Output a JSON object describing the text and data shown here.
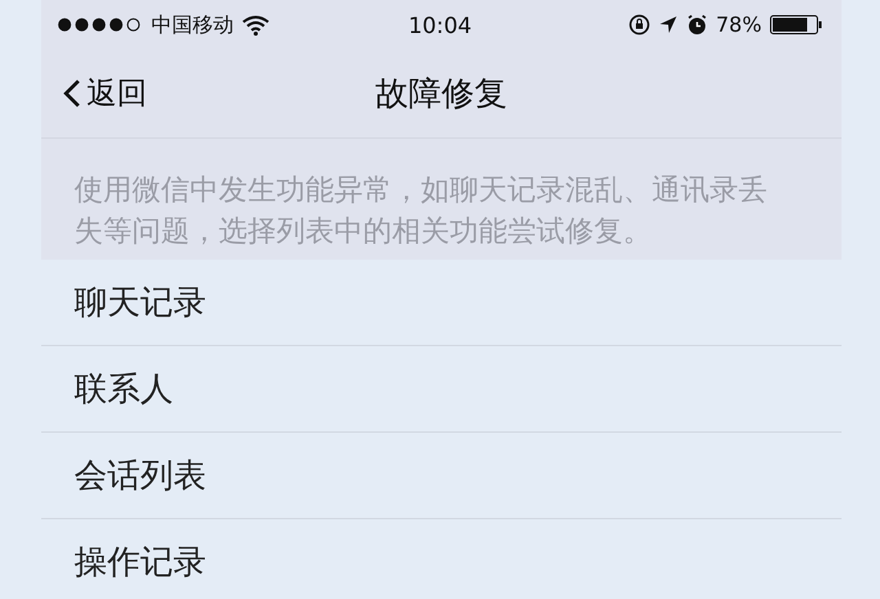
{
  "status_bar": {
    "carrier": "中国移动",
    "time": "10:04",
    "battery": "78%"
  },
  "nav_bar": {
    "back": "返回",
    "title": "故障修复"
  },
  "description": "使用微信中发生功能异常，如聊天记录混乱、通讯录丢失等问题，选择列表中的相关功能尝试修复。",
  "items": [
    {
      "label": "聊天记录"
    },
    {
      "label": "联系人"
    },
    {
      "label": "会话列表"
    },
    {
      "label": "操作记录"
    }
  ]
}
